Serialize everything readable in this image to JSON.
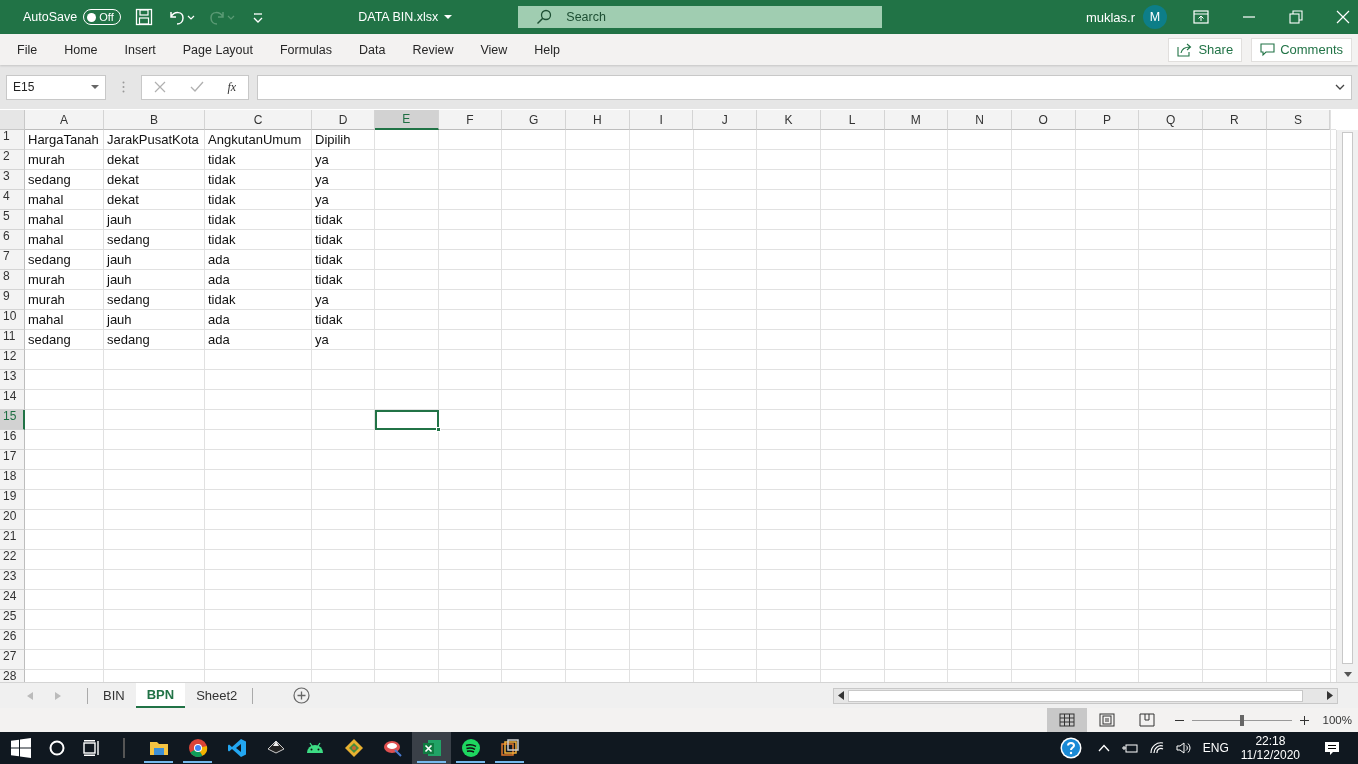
{
  "title_bar": {
    "autosave_label": "AutoSave",
    "autosave_on": false,
    "toggle_text": "Off",
    "file_name": "DATA BIN.xlsx",
    "search_placeholder": "Search",
    "user_name": "muklas.r",
    "avatar_initial": "M"
  },
  "menu_tabs": [
    {
      "label": "File",
      "selected": false
    },
    {
      "label": "Home",
      "selected": false
    },
    {
      "label": "Insert",
      "selected": false
    },
    {
      "label": "Page Layout",
      "selected": false
    },
    {
      "label": "Formulas",
      "selected": false
    },
    {
      "label": "Data",
      "selected": false
    },
    {
      "label": "Review",
      "selected": false
    },
    {
      "label": "View",
      "selected": false
    },
    {
      "label": "Help",
      "selected": false
    }
  ],
  "ribbon_buttons": [
    {
      "kind": "share",
      "label": "Share"
    },
    {
      "kind": "comments",
      "label": "Comments"
    }
  ],
  "formula_bar": {
    "name_box": "E15",
    "fx": "fx"
  },
  "sheet": {
    "columns": [
      {
        "label": "A",
        "selected": false
      },
      {
        "label": "B",
        "selected": false
      },
      {
        "label": "C",
        "selected": false
      },
      {
        "label": "D",
        "selected": false
      },
      {
        "label": "E",
        "selected": true
      },
      {
        "label": "F",
        "selected": false
      },
      {
        "label": "G",
        "selected": false
      },
      {
        "label": "H",
        "selected": false
      },
      {
        "label": "I",
        "selected": false
      },
      {
        "label": "J",
        "selected": false
      },
      {
        "label": "K",
        "selected": false
      },
      {
        "label": "L",
        "selected": false
      },
      {
        "label": "M",
        "selected": false
      },
      {
        "label": "N",
        "selected": false
      },
      {
        "label": "O",
        "selected": false
      },
      {
        "label": "P",
        "selected": false
      },
      {
        "label": "Q",
        "selected": false
      },
      {
        "label": "R",
        "selected": false
      },
      {
        "label": "S",
        "selected": false
      }
    ],
    "rows": [
      {
        "label": "1",
        "selected": false,
        "cells": [
          "HargaTanah",
          "JarakPusatKota",
          "AngkutanUmum",
          "Dipilih"
        ]
      },
      {
        "label": "2",
        "selected": false,
        "cells": [
          "murah",
          "dekat",
          "tidak",
          "ya"
        ]
      },
      {
        "label": "3",
        "selected": false,
        "cells": [
          "sedang",
          "dekat",
          "tidak",
          "ya"
        ]
      },
      {
        "label": "4",
        "selected": false,
        "cells": [
          "mahal",
          "dekat",
          "tidak",
          "ya"
        ]
      },
      {
        "label": "5",
        "selected": false,
        "cells": [
          "mahal",
          "jauh",
          "tidak",
          "tidak"
        ]
      },
      {
        "label": "6",
        "selected": false,
        "cells": [
          "mahal",
          "sedang",
          "tidak",
          "tidak"
        ]
      },
      {
        "label": "7",
        "selected": false,
        "cells": [
          "sedang",
          "jauh",
          "ada",
          "tidak"
        ]
      },
      {
        "label": "8",
        "selected": false,
        "cells": [
          "murah",
          "jauh",
          "ada",
          "tidak"
        ]
      },
      {
        "label": "9",
        "selected": false,
        "cells": [
          "murah",
          "sedang",
          "tidak",
          "ya"
        ]
      },
      {
        "label": "10",
        "selected": false,
        "cells": [
          "mahal",
          "jauh",
          "ada",
          "tidak"
        ]
      },
      {
        "label": "11",
        "selected": false,
        "cells": [
          "sedang",
          "sedang",
          "ada",
          "ya"
        ]
      },
      {
        "label": "12",
        "selected": false
      },
      {
        "label": "13",
        "selected": false
      },
      {
        "label": "14",
        "selected": false
      },
      {
        "label": "15",
        "selected": true
      },
      {
        "label": "16",
        "selected": false
      },
      {
        "label": "17",
        "selected": false
      },
      {
        "label": "18",
        "selected": false
      },
      {
        "label": "19",
        "selected": false
      },
      {
        "label": "20",
        "selected": false
      },
      {
        "label": "21",
        "selected": false
      },
      {
        "label": "22",
        "selected": false
      },
      {
        "label": "23",
        "selected": false
      },
      {
        "label": "24",
        "selected": false
      },
      {
        "label": "25",
        "selected": false
      },
      {
        "label": "26",
        "selected": false
      },
      {
        "label": "27",
        "selected": false
      },
      {
        "label": "28",
        "selected": false
      }
    ]
  },
  "sheet_tabs": [
    {
      "label": "BIN",
      "selected": false
    },
    {
      "label": "BPN",
      "selected": true
    },
    {
      "label": "Sheet2",
      "selected": false
    }
  ],
  "status_bar": {
    "views": [
      {
        "kind": "normal",
        "selected": true
      },
      {
        "kind": "page_layout",
        "selected": false
      },
      {
        "kind": "page_break",
        "selected": false
      }
    ],
    "zoom": {
      "level": 0.5
    },
    "zoom_text": "100%"
  },
  "taskbar": {
    "apps": [
      {
        "kind": "folder",
        "running": true,
        "active": false
      },
      {
        "kind": "browser",
        "running": true,
        "active": false
      },
      {
        "kind": "code",
        "running": false,
        "active": false
      },
      {
        "kind": "diamond",
        "running": false,
        "active": false
      },
      {
        "kind": "android",
        "running": false,
        "active": false
      },
      {
        "kind": "git",
        "running": false,
        "active": false
      },
      {
        "kind": "paint",
        "running": false,
        "active": false
      },
      {
        "kind": "excel",
        "running": true,
        "active": true
      },
      {
        "kind": "music",
        "running": true,
        "active": false
      },
      {
        "kind": "layers",
        "running": true,
        "active": false
      }
    ],
    "language": "ENG",
    "time": "22:18",
    "date": "11/12/2020"
  }
}
